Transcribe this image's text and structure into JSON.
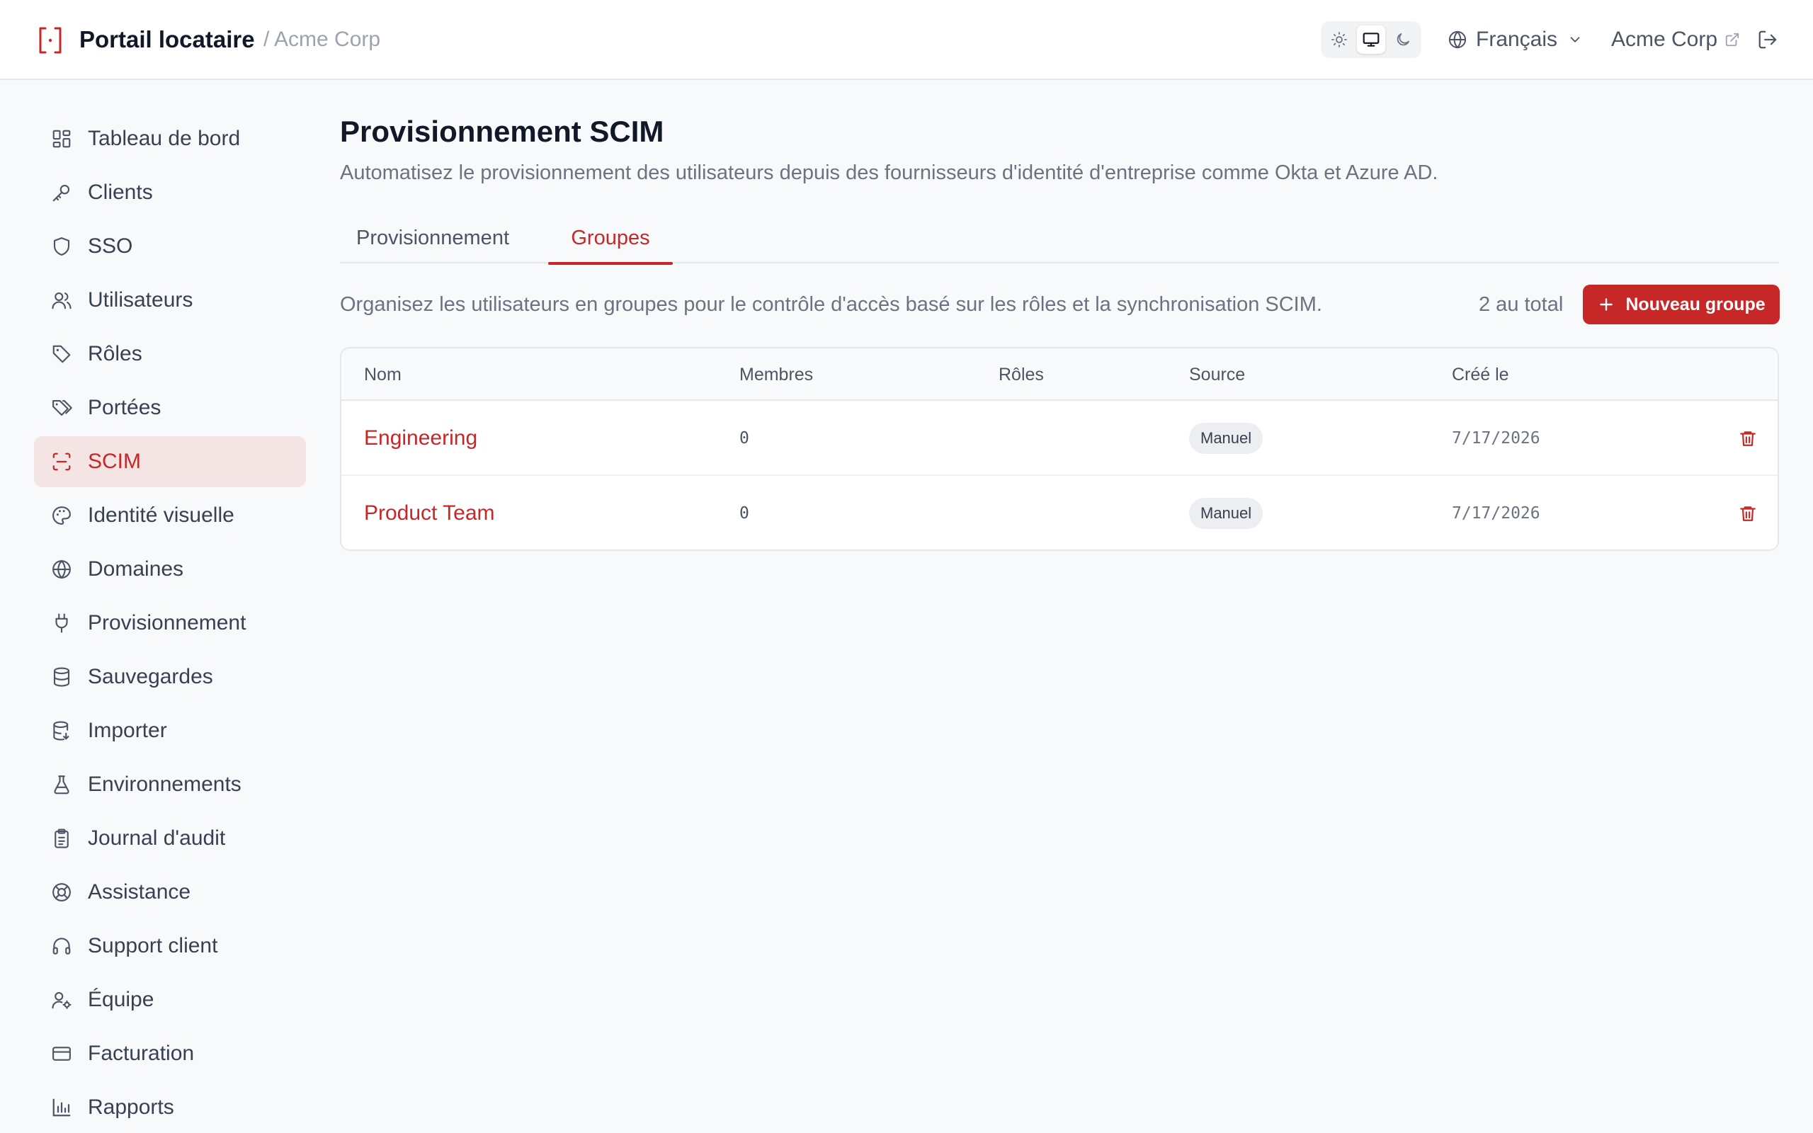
{
  "header": {
    "app_title": "Portail locataire",
    "tenant_crumb": "/ Acme Corp",
    "theme_options": [
      "light",
      "system",
      "dark"
    ],
    "theme_selected": "system",
    "language": "Français",
    "org_name": "Acme Corp",
    "icons": {
      "logo": "scan-bracket-logo-icon",
      "light": "sun-icon",
      "system": "monitor-icon",
      "dark": "moon-icon",
      "language": "globe-icon",
      "language_caret": "chevron-down-icon",
      "org_link": "external-link-icon",
      "logout": "logout-icon"
    }
  },
  "sidebar": {
    "items": [
      {
        "label": "Tableau de bord",
        "icon": "dashboard-icon"
      },
      {
        "label": "Clients",
        "icon": "key-icon"
      },
      {
        "label": "SSO",
        "icon": "shield-icon"
      },
      {
        "label": "Utilisateurs",
        "icon": "users-icon"
      },
      {
        "label": "Rôles",
        "icon": "tag-icon"
      },
      {
        "label": "Portées",
        "icon": "tags-icon"
      },
      {
        "label": "SCIM",
        "icon": "scan-icon",
        "active": true
      },
      {
        "label": "Identité visuelle",
        "icon": "palette-icon"
      },
      {
        "label": "Domaines",
        "icon": "globe-icon"
      },
      {
        "label": "Provisionnement",
        "icon": "plug-icon"
      },
      {
        "label": "Sauvegardes",
        "icon": "database-icon"
      },
      {
        "label": "Importer",
        "icon": "database-import-icon"
      },
      {
        "label": "Environnements",
        "icon": "flask-icon"
      },
      {
        "label": "Journal d'audit",
        "icon": "clipboard-icon"
      },
      {
        "label": "Assistance",
        "icon": "lifebuoy-icon"
      },
      {
        "label": "Support client",
        "icon": "headset-icon"
      },
      {
        "label": "Équipe",
        "icon": "user-cog-icon"
      },
      {
        "label": "Facturation",
        "icon": "credit-card-icon"
      },
      {
        "label": "Rapports",
        "icon": "bar-chart-icon"
      }
    ]
  },
  "main": {
    "title": "Provisionnement SCIM",
    "subtitle": "Automatisez le provisionnement des utilisateurs depuis des fournisseurs d'identité d'entreprise comme Okta et Azure AD.",
    "tabs": [
      {
        "label": "Provisionnement",
        "active": false
      },
      {
        "label": "Groupes",
        "active": true
      }
    ],
    "section_description": "Organisez les utilisateurs en groupes pour le contrôle d'accès basé sur les rôles et la synchronisation SCIM.",
    "total_count": "2 au total",
    "new_group_label": "Nouveau groupe",
    "table": {
      "columns": [
        "Nom",
        "Membres",
        "Rôles",
        "Source",
        "Créé le"
      ],
      "rows": [
        {
          "name": "Engineering",
          "members": "0",
          "roles": "",
          "source": "Manuel",
          "created": "7/17/2026"
        },
        {
          "name": "Product Team",
          "members": "0",
          "roles": "",
          "source": "Manuel",
          "created": "7/17/2026"
        }
      ]
    }
  },
  "colors": {
    "accent": "#c62828",
    "accent_soft": "#f5e4e4",
    "text_primary": "#111827",
    "text_muted": "#6b7280",
    "border": "#e5e7eb"
  }
}
